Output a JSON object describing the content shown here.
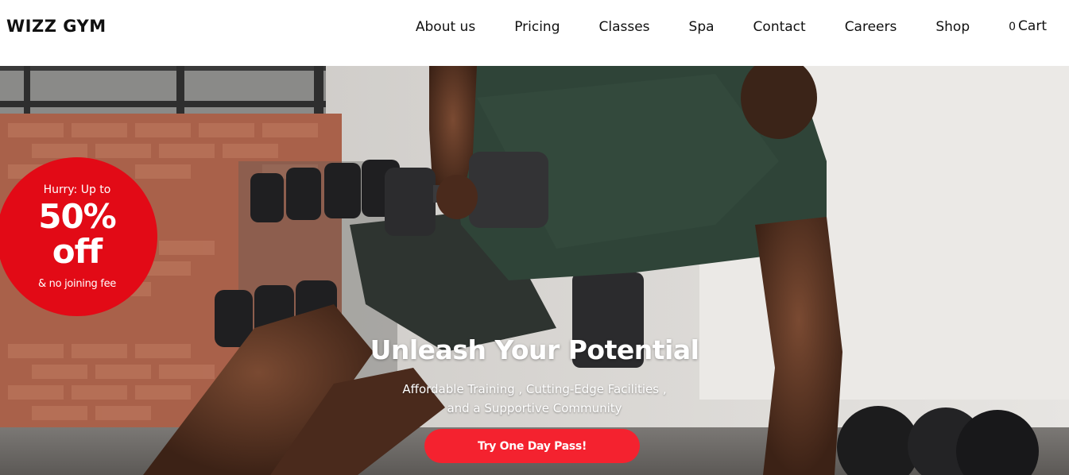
{
  "header": {
    "logo": "WIZZ GYM",
    "nav": [
      "About us",
      "Pricing",
      "Classes",
      "Spa",
      "Contact",
      "Careers",
      "Shop"
    ],
    "cart_count": "0",
    "cart_label": "Cart"
  },
  "promo": {
    "line1": "Hurry: Up to",
    "big1": "50%",
    "big2": "off",
    "line2": "& no joining fee",
    "color": "#e20a16"
  },
  "hero": {
    "title": "Unleash Your Potential",
    "subtitle_line1": "Affordable Training , Cutting-Edge Facilities ,",
    "subtitle_line2": "and a Supportive Community",
    "cta": "Try One Day Pass!",
    "cta_color": "#f4222f"
  }
}
